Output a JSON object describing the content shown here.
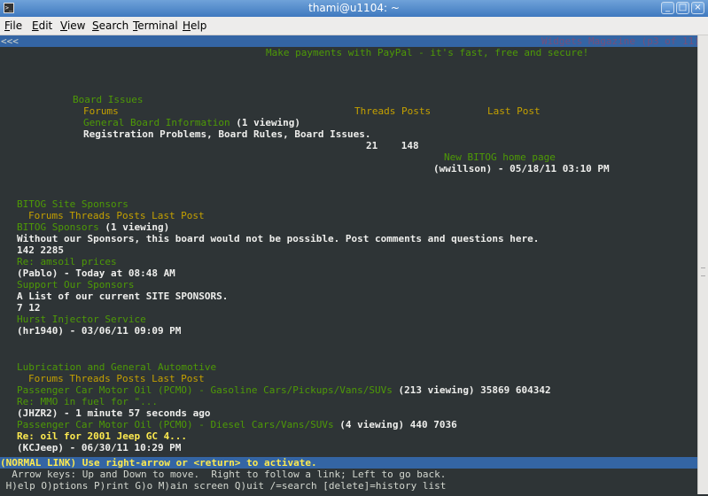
{
  "window": {
    "title": "thami@u1104: ~",
    "app_icon": "terminal-icon",
    "buttons": [
      "_",
      "□",
      "×"
    ]
  },
  "menubar": [
    {
      "key": "F",
      "rest": "ile"
    },
    {
      "key": "E",
      "rest": "dit"
    },
    {
      "key": "V",
      "rest": "iew"
    },
    {
      "key": "S",
      "rest": "earch"
    },
    {
      "key": "T",
      "rest": "erminal"
    },
    {
      "key": "H",
      "rest": "elp"
    }
  ],
  "page": {
    "back": "<<<",
    "page_title": "Widgets Magazine (p3 of 11)",
    "banner": "Make payments with PayPal - it's fast, free and secure!",
    "section1": {
      "heading": "Board Issues",
      "forums": "Forums",
      "threads_posts": "Threads Posts",
      "last_post": "Last Post",
      "forum_name": "General Board Information",
      "forum_viewing": "(1 viewing)",
      "forum_desc": "Registration Problems, Board Rules, Board Issues.",
      "counts": "21    148",
      "last_post_link": "New BITOG home page",
      "last_post_meta": "(wwillson) - 05/18/11 03:10 PM"
    },
    "section2": {
      "heading": "BITOG Site Sponsors",
      "cols": "Forums Threads Posts Last Post",
      "forum1_name": "BITOG Sponsors",
      "forum1_viewing": "(1 viewing)",
      "forum1_desc": "Without our Sponsors, this board would not be possible. Post comments and questions here.",
      "forum1_counts": "142 2285",
      "forum1_last": "Re: amsoil prices",
      "forum1_meta": "(Pablo) - Today at 08:48 AM",
      "forum2_name": "Support Our Sponsors",
      "forum2_desc": "A List of our current SITE SPONSORS.",
      "forum2_counts": "7 12",
      "forum2_last": "Hurst Injector Service",
      "forum2_meta": "(hr1940) - 03/06/11 09:09 PM"
    },
    "section3": {
      "heading": "Lubrication and General Automotive",
      "cols": "Forums Threads Posts Last Post",
      "forum1_name": "Passenger Car Motor Oil (PCMO) - Gasoline Cars/Pickups/Vans/SUVs",
      "forum1_info": " (213 viewing) 35869 604342",
      "forum1_last": "Re: MMO in fuel for \"...",
      "forum1_meta": "(JHZR2) - 1 minute 57 seconds ago",
      "forum2_name": "Passenger Car Motor Oil (PCMO) - Diesel Cars/Vans/SUVs",
      "forum2_info": " (4 viewing) 440 7036",
      "forum2_last": "Re: oil for 2001 Jeep GC 4...",
      "forum2_meta": "(KCJeep) - 06/30/11 10:29 PM"
    }
  },
  "status_line": "(NORMAL LINK) Use right-arrow or <return> to activate.",
  "help1": "  Arrow keys: Up and Down to move.  Right to follow a link; Left to go back.",
  "help2": " H)elp O)ptions P)rint G)o M)ain screen Q)uit /=search [delete]=history list"
}
